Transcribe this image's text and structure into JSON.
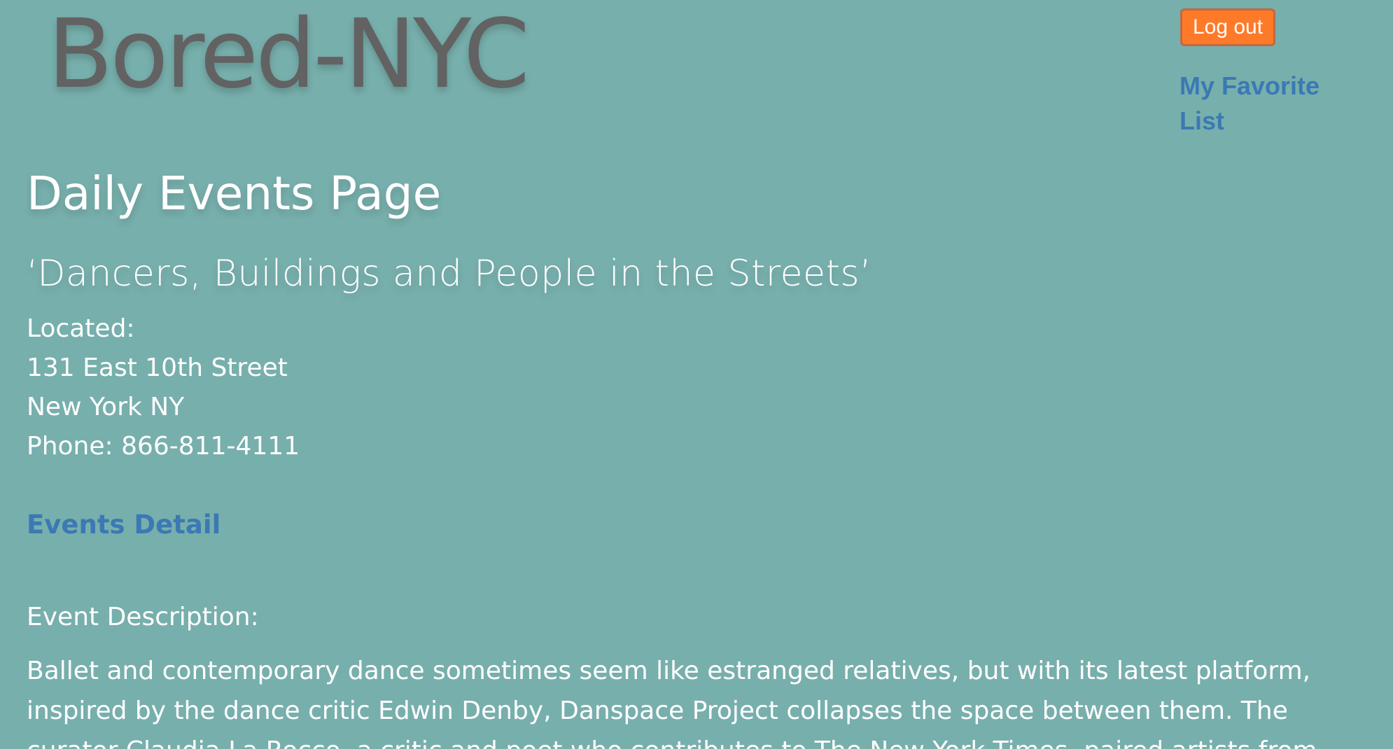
{
  "header": {
    "logo_text": "Bored-NYC",
    "logout_label": "Log out",
    "favorite_link": "My Favorite List"
  },
  "page": {
    "title": "Daily Events Page",
    "event_title": "‘Dancers, Buildings and People in the Streets’"
  },
  "location": {
    "label": "Located:",
    "street": "131 East 10th Street",
    "city": "New York NY",
    "phone": "Phone: 866-811-4111"
  },
  "links": {
    "events_detail": "Events Detail"
  },
  "description": {
    "label": "Event Description:",
    "text": "Ballet and contemporary dance sometimes seem like estranged relatives, but with its latest platform, inspired by the dance critic Edwin Denby, Danspace Project collapses the space between them. The curator Claudia La Rocco, a critic and poet who contributes to The New York Times, paired artists from"
  },
  "colors": {
    "background": "#77afac",
    "logo": "#626262",
    "link": "#3b79b4",
    "logout_button": "#ff7a28"
  }
}
